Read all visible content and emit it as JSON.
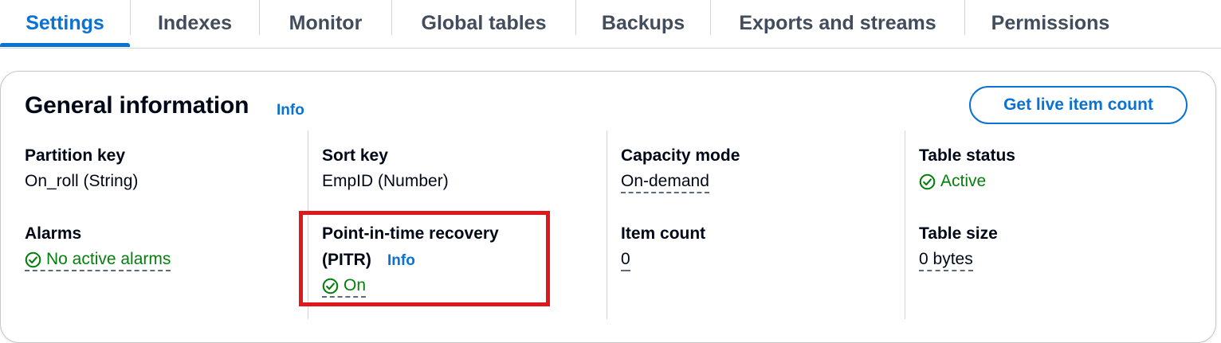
{
  "tabs": [
    {
      "label": "Settings",
      "active": true
    },
    {
      "label": "Indexes"
    },
    {
      "label": "Monitor"
    },
    {
      "label": "Global tables"
    },
    {
      "label": "Backups"
    },
    {
      "label": "Exports and streams"
    },
    {
      "label": "Permissions"
    }
  ],
  "general": {
    "title": "General information",
    "info": "Info",
    "live_count_button": "Get live item count"
  },
  "fields": {
    "partition_key": {
      "label": "Partition key",
      "value": "On_roll (String)"
    },
    "sort_key": {
      "label": "Sort key",
      "value": "EmpID (Number)"
    },
    "capacity_mode": {
      "label": "Capacity mode",
      "value": "On-demand"
    },
    "table_status": {
      "label": "Table status",
      "value": "Active"
    },
    "alarms": {
      "label": "Alarms",
      "value": "No active alarms"
    },
    "pitr": {
      "label_line1": "Point-in-time recovery",
      "label_line2": "(PITR)",
      "info": "Info",
      "value": "On"
    },
    "item_count": {
      "label": "Item count",
      "value": "0"
    },
    "table_size": {
      "label": "Table size",
      "value": "0 bytes"
    }
  },
  "colors": {
    "accent": "#0972d3",
    "success": "#037f0c",
    "highlight": "#e0181c"
  },
  "icons": {
    "status": "check-circle-icon"
  }
}
